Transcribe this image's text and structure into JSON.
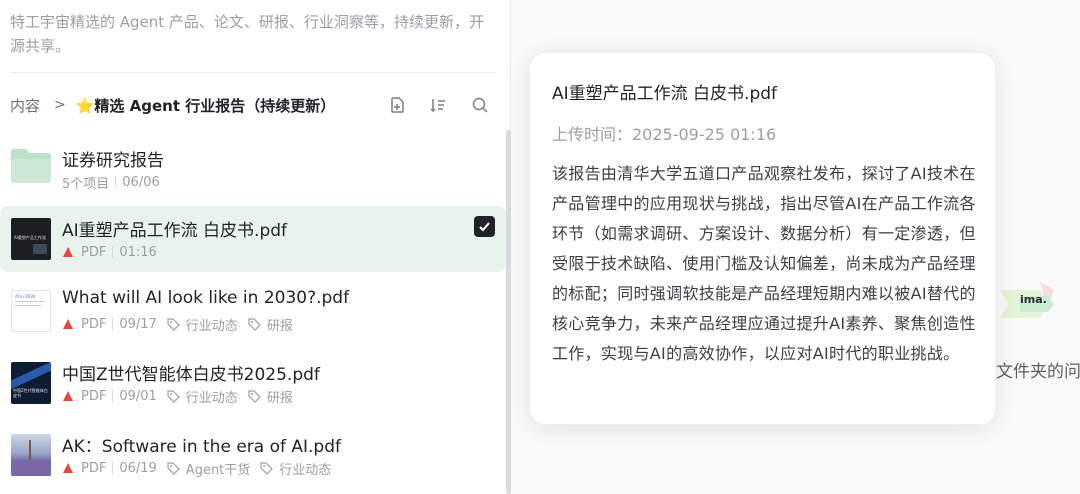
{
  "sidebar": {
    "description": "特工宇宙精选的 Agent 产品、论文、研报、行业洞察等，持续更新，开源共享。",
    "breadcrumb": {
      "root": "内容",
      "separator": ">",
      "current": "⭐精选 Agent 行业报告（持续更新）"
    },
    "toolbar": {
      "icons": [
        "add-doc-icon",
        "sort-icon",
        "search-icon"
      ]
    },
    "items": [
      {
        "title": "证券研究报告",
        "kind": "folder",
        "count": "5个项目",
        "date": "06/06"
      },
      {
        "title": "AI重塑产品工作流 白皮书.pdf",
        "kind": "pdf",
        "type_label": "PDF",
        "date": "01:16",
        "thumb_text": "AI重塑产品工作流",
        "selected": true
      },
      {
        "title": "What will AI look like in 2030?.pdf",
        "kind": "pdf",
        "type_label": "PDF",
        "date": "09/17",
        "thumb_text": "AI in 2030",
        "tags": [
          "行业动态",
          "研报"
        ]
      },
      {
        "title": "中国Z世代智能体白皮书2025.pdf",
        "kind": "pdf",
        "type_label": "PDF",
        "date": "09/01",
        "thumb_text": "中国Z世代智能体白皮书",
        "tags": [
          "行业动态",
          "研报"
        ]
      },
      {
        "title": "AK：Software in the era of AI.pdf",
        "kind": "pdf",
        "type_label": "PDF",
        "date": "06/19",
        "tags": [
          "Agent干货",
          "行业动态"
        ]
      }
    ]
  },
  "popup": {
    "title": "AI重塑产品工作流 白皮书.pdf",
    "upload_time": "上传时间：2025-09-25 01:16",
    "summary": "该报告由清华大学五道口产品观察社发布，探讨了AI技术在产品管理中的应用现状与挑战，指出尽管AI在产品工作流各环节（如需求调研、方案设计、数据分析）有一定渗透，但受限于技术缺陷、使用门槛及认知偏差，尚未成为产品经理的标配；同时强调软技能是产品经理短期内难以被AI替代的核心竞争力，未来产品经理应通过提升AI素养、聚焦创造性工作，实现与AI的高效协作，以应对AI时代的职业挑战。"
  },
  "background": {
    "partial_text": "文件夹的问题",
    "logo_text": "ima."
  },
  "colors": {
    "selected_row": "#e9f3ed",
    "pdf_red": "#e5483d",
    "folder_green": "#bfe0c9"
  }
}
